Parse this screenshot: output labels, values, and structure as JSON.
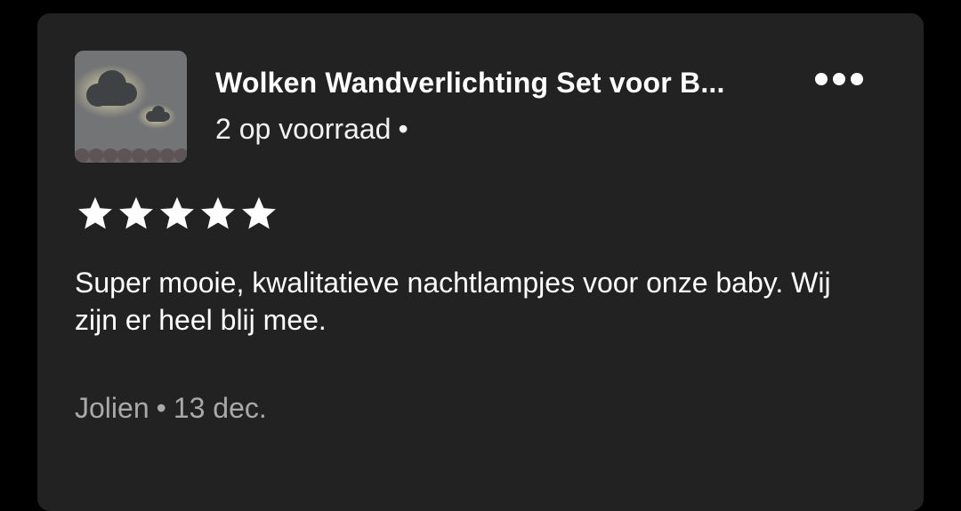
{
  "listing": {
    "title": "Wolken Wandverlichting Set voor B...",
    "stock": "2 op voorraad",
    "stock_separator": "•",
    "thumbnail_icon": "cloud-lamp-thumbnail"
  },
  "menu": {
    "icon": "more-options-icon"
  },
  "rating": {
    "value": 5,
    "max": 5,
    "star_color": "#ffffff"
  },
  "review": {
    "text": "Super mooie, kwalitatieve nachtlampjes voor onze baby. Wij zijn er heel blij mee."
  },
  "meta": {
    "author": "Jolien",
    "separator": "•",
    "date": "13 dec."
  },
  "colors": {
    "background": "#000000",
    "card": "#222222",
    "primary_text": "#ffffff",
    "secondary_text": "#a9a9a9"
  }
}
